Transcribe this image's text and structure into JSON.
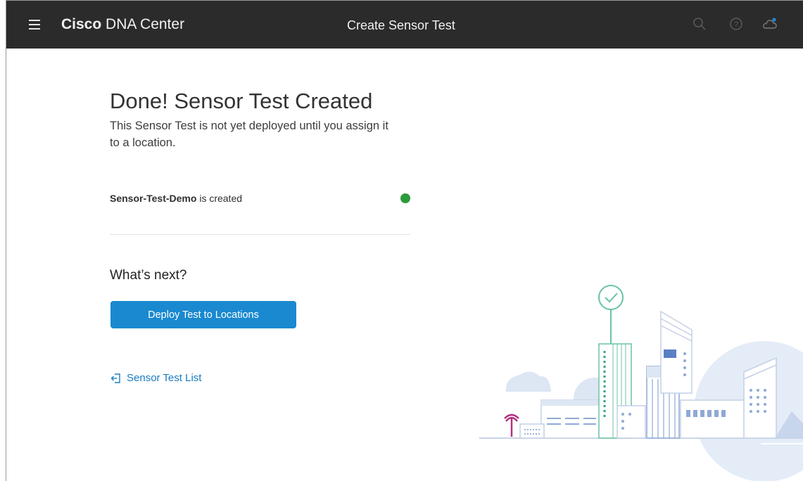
{
  "header": {
    "brand_bold": "Cisco",
    "brand_rest": " DNA Center",
    "page_title": "Create Sensor Test",
    "icons": [
      "menu-icon",
      "search-icon",
      "help-icon",
      "cloud-notification-icon"
    ]
  },
  "main": {
    "heading": "Done! Sensor Test Created",
    "subtext": "This Sensor Test is not yet deployed until you assign it to a location.",
    "created_name": "Sensor-Test-Demo",
    "created_suffix": " is created",
    "status_color": "#2c9b3b",
    "next_heading": "What’s next?",
    "deploy_button": "Deploy Test to Locations",
    "list_link": "Sensor Test List"
  },
  "colors": {
    "topbar": "#2b2b2b",
    "primary": "#1a89d0",
    "link": "#1a7cc1"
  }
}
